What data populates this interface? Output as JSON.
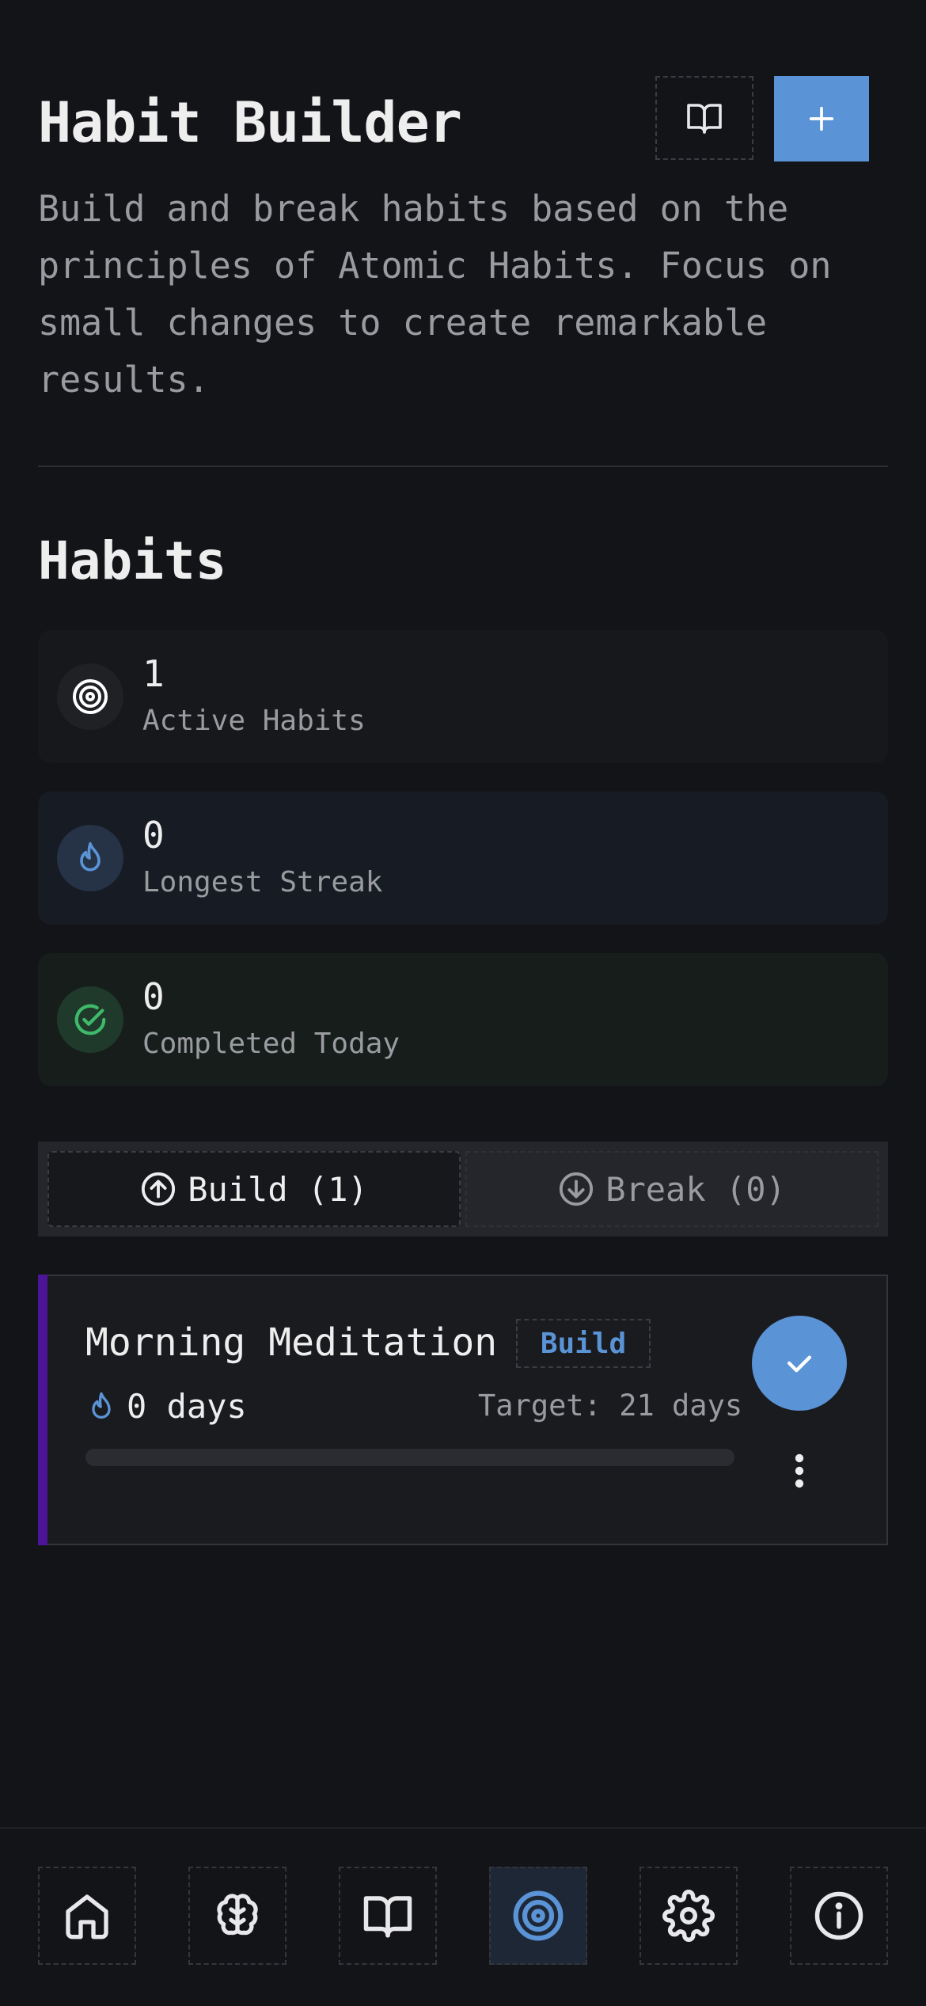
{
  "header": {
    "title": "Habit Builder",
    "subtitle": "Build and break habits based on the principles of Atomic Habits. Focus on small changes to create remarkable results.",
    "guide_icon": "book-open-icon",
    "add_icon": "plus-icon"
  },
  "section": {
    "title": "Habits"
  },
  "stats": [
    {
      "value": "1",
      "label": "Active Habits",
      "icon": "target-icon"
    },
    {
      "value": "0",
      "label": "Longest Streak",
      "icon": "flame-icon"
    },
    {
      "value": "0",
      "label": "Completed Today",
      "icon": "check-circle-icon"
    }
  ],
  "tabs": [
    {
      "label": "Build (1)",
      "icon": "arrow-up-circle-icon",
      "selected": true
    },
    {
      "label": "Break (0)",
      "icon": "arrow-down-circle-icon",
      "selected": false
    }
  ],
  "habits": [
    {
      "name": "Morning Meditation",
      "type": "Build",
      "streak": "0 days",
      "target": "Target: 21 days",
      "progress": 0
    }
  ],
  "nav": [
    {
      "name": "home",
      "icon": "home-icon"
    },
    {
      "name": "brain",
      "icon": "brain-icon"
    },
    {
      "name": "journal",
      "icon": "book-open-icon"
    },
    {
      "name": "habits",
      "icon": "target-icon",
      "active": true
    },
    {
      "name": "settings",
      "icon": "gear-icon"
    },
    {
      "name": "about",
      "icon": "info-icon"
    }
  ],
  "colors": {
    "background": "#131417",
    "accent": "#5a93d6",
    "success": "#3fb96a",
    "card_stripe": "#4c1496"
  }
}
